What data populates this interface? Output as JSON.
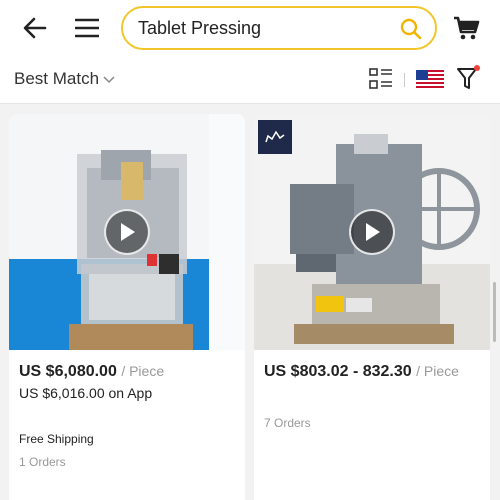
{
  "header": {
    "back_icon": "arrow-left-icon",
    "menu_icon": "hamburger-icon",
    "search": {
      "value": "Tablet Pressing",
      "icon": "search-icon",
      "border_color": "#f0c62a"
    },
    "cart_icon": "cart-icon"
  },
  "toolbar": {
    "sort_label": "Best Match",
    "sort_icon": "chevron-down-icon",
    "view_icon": "list-view-icon",
    "region_flag": "us-flag-icon",
    "filter_icon": "filter-icon",
    "filter_dot_color": "#f04438"
  },
  "products": [
    {
      "price": "US $6,080.00",
      "unit": "/ Piece",
      "app_price": "US $6,016.00 on App",
      "shipping": "Free Shipping",
      "orders": "1 Orders",
      "has_video": true
    },
    {
      "price": "US $803.02 - 832.30",
      "unit": "/ Piece",
      "orders": "7 Orders",
      "has_video": true
    }
  ]
}
